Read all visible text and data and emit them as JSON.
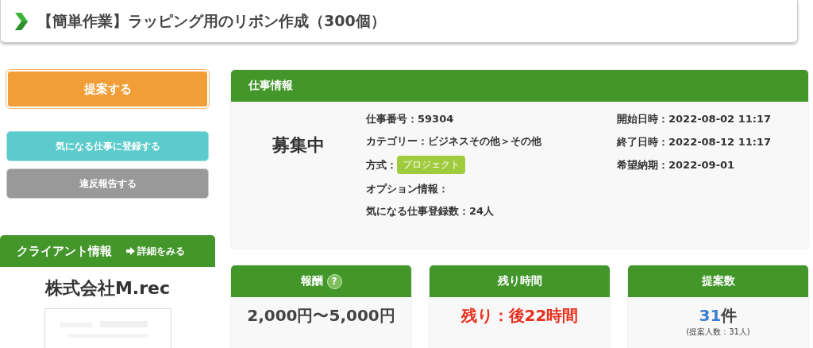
{
  "title": "【簡単作業】ラッピング用のリボン作成（300個）",
  "actions": [
    {
      "label": "提案する",
      "kind": "primary"
    },
    {
      "label": "気になる仕事に登録する",
      "kind": "watch"
    },
    {
      "label": "違反報告する",
      "kind": "report"
    }
  ],
  "client": {
    "heading": "クライアント情報",
    "link": "詳細をみる",
    "name": "株式会社M.rec"
  },
  "job": {
    "heading": "仕事情報",
    "status": "募集中",
    "details": [
      {
        "label": "仕事番号：",
        "value": "59304"
      },
      {
        "label": "カテゴリー：",
        "value": "ビジネスその他＞その他"
      },
      {
        "label": "方式：",
        "tag": "プロジェクト"
      },
      {
        "label": "オプション情報："
      },
      {
        "label": "気になる仕事登録数：",
        "value": "24人"
      }
    ],
    "dates": [
      {
        "label": "開始日時：",
        "value": "2022-08-02 11:17"
      },
      {
        "label": "終了日時：",
        "value": "2022-08-12 11:17"
      },
      {
        "label": "希望納期：",
        "value": "2022-09-01"
      }
    ]
  },
  "stats": [
    {
      "heading": "報酬",
      "help": "?",
      "kind": "reward",
      "value": "2,000円〜5,000円"
    },
    {
      "heading": "残り時間",
      "kind": "time",
      "value": "残り：後22時間"
    },
    {
      "heading": "提案数",
      "kind": "count",
      "value": "31",
      "unit": "件",
      "note": "(提案人数：31人)"
    }
  ]
}
